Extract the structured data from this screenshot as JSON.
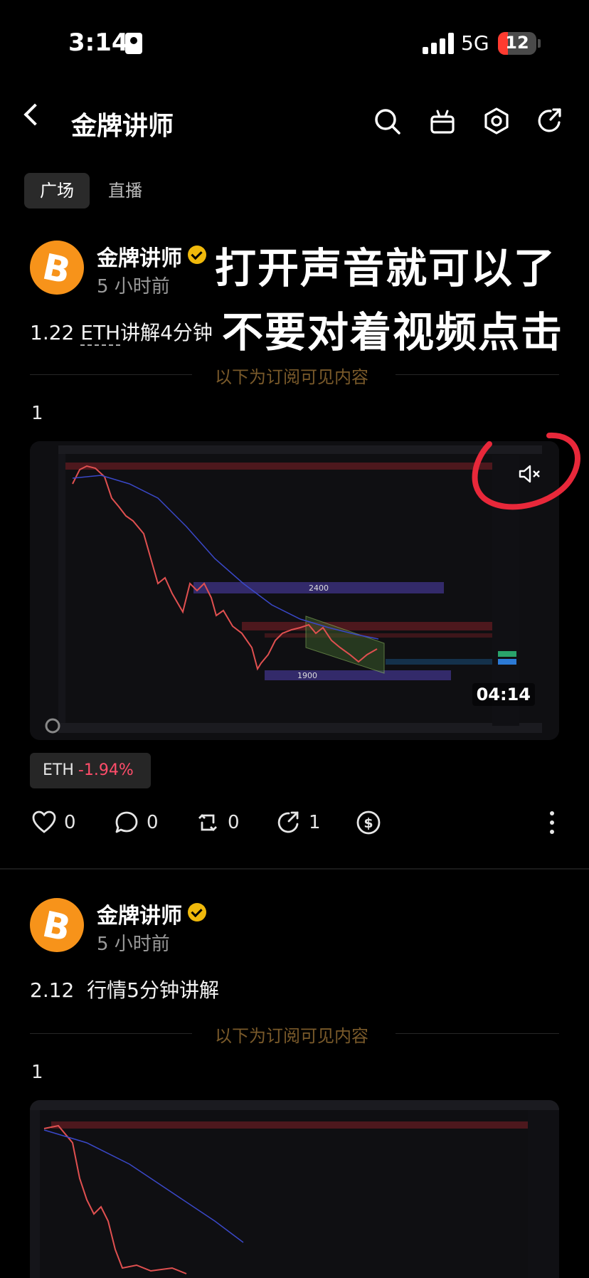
{
  "status_bar": {
    "time": "3:14",
    "network": "5G",
    "battery": "12"
  },
  "header": {
    "title": "金牌讲师"
  },
  "tabs": [
    {
      "label": "广场",
      "active": true
    },
    {
      "label": "直播",
      "active": false
    }
  ],
  "overlay": {
    "line1": "打开声音就可以了",
    "line2": "不要对着视频点击"
  },
  "posts": [
    {
      "author": "金牌讲师",
      "time_ago": "5 小时前",
      "title_prefix": "1.22 ",
      "title_ticker": "ETH",
      "title_rest": "讲解4分钟",
      "subscription_divider": "以下为订阅可见内容",
      "body": "1",
      "video": {
        "duration": "04:14",
        "chart_labels": {
          "zone_upper": "2400",
          "zone_lower": "1900"
        }
      },
      "ticker_chip": {
        "symbol": "ETH",
        "change": "-1.94%"
      },
      "actions": {
        "likes": "0",
        "comments": "0",
        "reposts": "0",
        "shares": "1"
      }
    },
    {
      "author": "金牌讲师",
      "time_ago": "5 小时前",
      "title": "2.12  行情5分钟讲解",
      "subscription_divider": "以下为订阅可见内容",
      "body": "1"
    }
  ],
  "icons": {
    "back": "chevron-left-icon",
    "search": "search-icon",
    "gift": "gift-icon",
    "settings": "hexagon-settings-icon",
    "share": "share-icon",
    "muted": "speaker-muted-icon",
    "like": "heart-icon",
    "comment": "comment-icon",
    "repost": "repost-icon",
    "share_action": "share-arrow-icon",
    "tip": "dollar-icon",
    "more": "more-vertical-icon"
  },
  "colors": {
    "accent_gold": "#f0b90b",
    "negative": "#ff4d6a",
    "btc_orange": "#f7931a",
    "annotation_red": "#e8283a"
  }
}
